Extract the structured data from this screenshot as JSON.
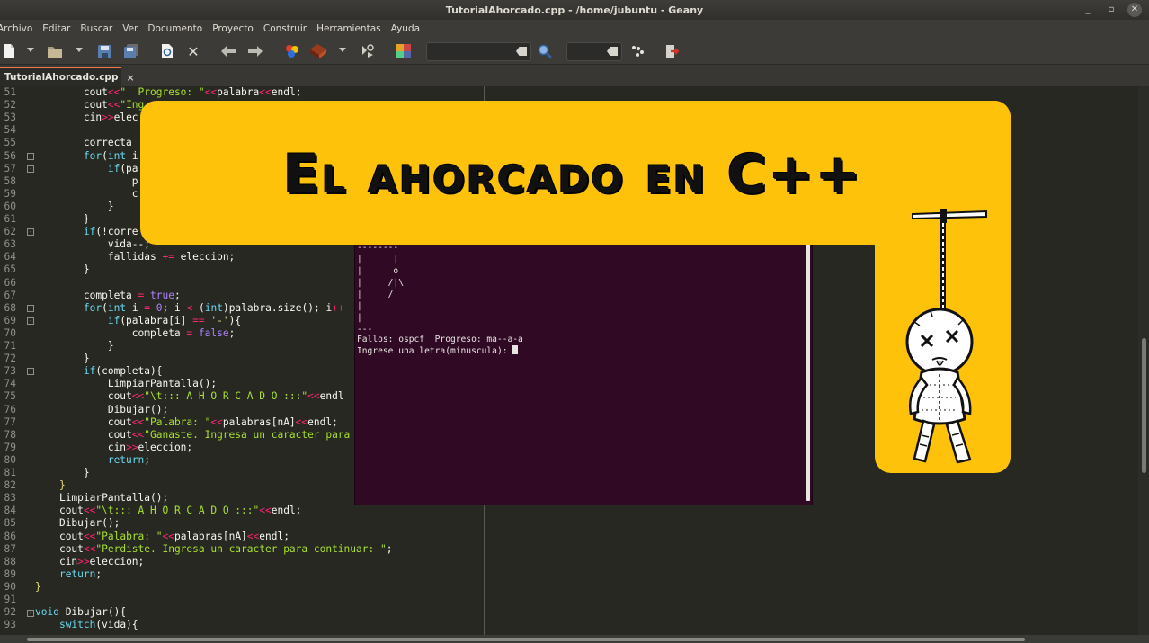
{
  "window": {
    "title": "TutorialAhorcado.cpp - /home/jubuntu - Geany"
  },
  "menubar": {
    "items": [
      "Archivo",
      "Editar",
      "Buscar",
      "Ver",
      "Documento",
      "Proyecto",
      "Construir",
      "Herramientas",
      "Ayuda"
    ]
  },
  "tab": {
    "label": "TutorialAhorcado.cpp",
    "close": "×"
  },
  "editor": {
    "line_numbers": [
      "51",
      "52",
      "53",
      "54",
      "55",
      "56",
      "57",
      "58",
      "59",
      "60",
      "61",
      "62",
      "63",
      "64",
      "65",
      "66",
      "67",
      "68",
      "69",
      "70",
      "71",
      "72",
      "73",
      "74",
      "75",
      "76",
      "77",
      "78",
      "79",
      "80",
      "81",
      "82",
      "83",
      "84",
      "85",
      "86",
      "87",
      "88",
      "89",
      "90",
      "91",
      "92",
      "93"
    ]
  },
  "terminal": {
    "lines": [
      "--------",
      "|      |",
      "|      o",
      "|     /|\\",
      "|     /",
      "|",
      "|",
      "---",
      "Fallos: ospcf  Progreso: ma--a-a",
      "Ingrese una letra(minuscula): "
    ]
  },
  "banner": {
    "title": "El ahorcado en C++"
  },
  "colors": {
    "banner": "#fec20b",
    "editor_bg": "#272822",
    "terminal_bg": "#300a24",
    "tab_accent": "#f07746"
  }
}
